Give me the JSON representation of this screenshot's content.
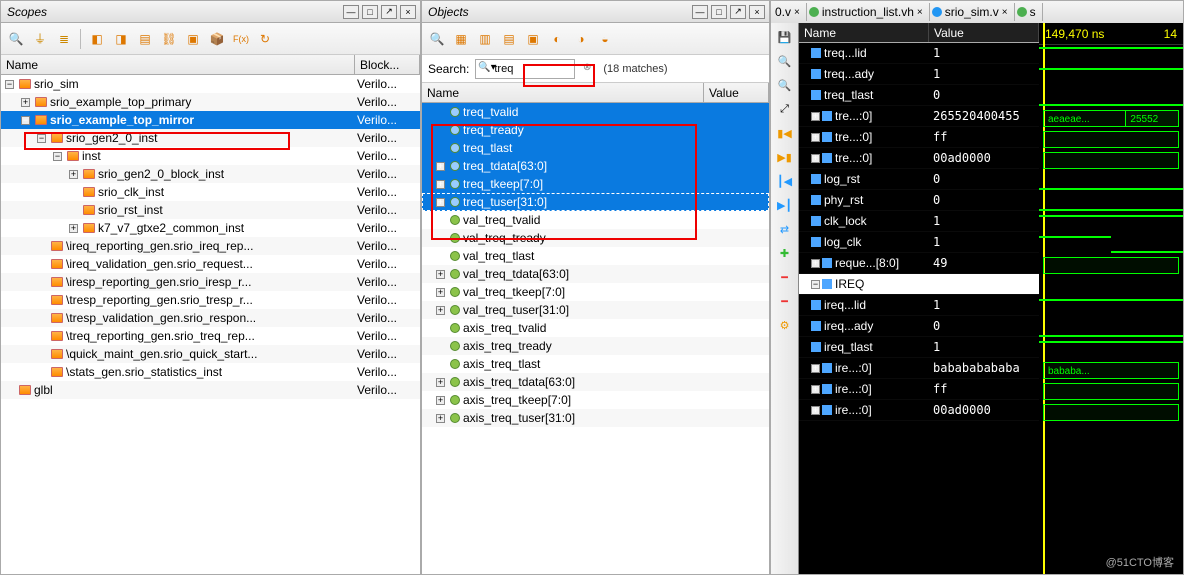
{
  "scopes": {
    "title": "Scopes",
    "col_name": "Name",
    "col_block": "Block...",
    "tree": [
      {
        "depth": 0,
        "exp": "-",
        "icon": "cube",
        "label": "srio_sim",
        "block": "Verilo..."
      },
      {
        "depth": 1,
        "exp": "+",
        "icon": "cube",
        "label": "srio_example_top_primary",
        "block": "Verilo...",
        "zebra": true
      },
      {
        "depth": 1,
        "exp": "-",
        "icon": "cube",
        "label": "srio_example_top_mirror",
        "block": "Verilo...",
        "sel": true,
        "red": true,
        "bold": true
      },
      {
        "depth": 2,
        "exp": "-",
        "icon": "cube",
        "label": "srio_gen2_0_inst",
        "block": "Verilo...",
        "zebra": true
      },
      {
        "depth": 3,
        "exp": "-",
        "icon": "cube",
        "label": "inst",
        "block": "Verilo..."
      },
      {
        "depth": 4,
        "exp": "+",
        "icon": "cube",
        "label": "srio_gen2_0_block_inst",
        "block": "Verilo...",
        "zebra": true
      },
      {
        "depth": 4,
        "exp": "",
        "icon": "cube",
        "label": "srio_clk_inst",
        "block": "Verilo..."
      },
      {
        "depth": 4,
        "exp": "",
        "icon": "cube",
        "label": "srio_rst_inst",
        "block": "Verilo...",
        "zebra": true
      },
      {
        "depth": 4,
        "exp": "+",
        "icon": "cube",
        "label": "k7_v7_gtxe2_common_inst",
        "block": "Verilo..."
      },
      {
        "depth": 2,
        "exp": "",
        "icon": "cube",
        "label": "\\ireq_reporting_gen.srio_ireq_rep...",
        "block": "Verilo...",
        "zebra": true
      },
      {
        "depth": 2,
        "exp": "",
        "icon": "cube",
        "label": "\\ireq_validation_gen.srio_request...",
        "block": "Verilo..."
      },
      {
        "depth": 2,
        "exp": "",
        "icon": "cube",
        "label": "\\iresp_reporting_gen.srio_iresp_r...",
        "block": "Verilo...",
        "zebra": true
      },
      {
        "depth": 2,
        "exp": "",
        "icon": "cube",
        "label": "\\tresp_reporting_gen.srio_tresp_r...",
        "block": "Verilo..."
      },
      {
        "depth": 2,
        "exp": "",
        "icon": "cube",
        "label": "\\tresp_validation_gen.srio_respon...",
        "block": "Verilo...",
        "zebra": true
      },
      {
        "depth": 2,
        "exp": "",
        "icon": "cube",
        "label": "\\treq_reporting_gen.srio_treq_rep...",
        "block": "Verilo..."
      },
      {
        "depth": 2,
        "exp": "",
        "icon": "cube",
        "label": "\\quick_maint_gen.srio_quick_start...",
        "block": "Verilo...",
        "zebra": true
      },
      {
        "depth": 2,
        "exp": "",
        "icon": "cube",
        "label": "\\stats_gen.srio_statistics_inst",
        "block": "Verilo..."
      },
      {
        "depth": 0,
        "exp": "",
        "icon": "cube",
        "label": "glbl",
        "block": "Verilo...",
        "zebra": true
      }
    ]
  },
  "objects": {
    "title": "Objects",
    "search_label": "Search:",
    "search_value": "treq",
    "matches": "(18 matches)",
    "col_name": "Name",
    "col_value": "Value",
    "list": [
      {
        "depth": 0,
        "icon": "port",
        "label": "treq_tvalid",
        "sel": true
      },
      {
        "depth": 0,
        "icon": "port",
        "label": "treq_tready",
        "sel": true
      },
      {
        "depth": 0,
        "icon": "port",
        "label": "treq_tlast",
        "sel": true
      },
      {
        "depth": 0,
        "exp": "+",
        "icon": "port",
        "label": "treq_tdata[63:0]",
        "sel": true
      },
      {
        "depth": 0,
        "exp": "+",
        "icon": "port",
        "label": "treq_tkeep[7:0]",
        "sel": true
      },
      {
        "depth": 0,
        "exp": "+",
        "icon": "port",
        "label": "treq_tuser[31:0]",
        "sel": true,
        "dashed": true
      },
      {
        "depth": 0,
        "icon": "port",
        "label": "val_treq_tvalid"
      },
      {
        "depth": 0,
        "icon": "port",
        "label": "val_treq_tready",
        "zebra": true
      },
      {
        "depth": 0,
        "icon": "port",
        "label": "val_treq_tlast"
      },
      {
        "depth": 0,
        "exp": "+",
        "icon": "port",
        "label": "val_treq_tdata[63:0]",
        "zebra": true
      },
      {
        "depth": 0,
        "exp": "+",
        "icon": "port",
        "label": "val_treq_tkeep[7:0]"
      },
      {
        "depth": 0,
        "exp": "+",
        "icon": "port",
        "label": "val_treq_tuser[31:0]",
        "zebra": true
      },
      {
        "depth": 0,
        "icon": "port",
        "label": "axis_treq_tvalid"
      },
      {
        "depth": 0,
        "icon": "port",
        "label": "axis_treq_tready",
        "zebra": true
      },
      {
        "depth": 0,
        "icon": "port",
        "label": "axis_treq_tlast"
      },
      {
        "depth": 0,
        "exp": "+",
        "icon": "port",
        "label": "axis_treq_tdata[63:0]",
        "zebra": true
      },
      {
        "depth": 0,
        "exp": "+",
        "icon": "port",
        "label": "axis_treq_tkeep[7:0]"
      },
      {
        "depth": 0,
        "exp": "+",
        "icon": "port",
        "label": "axis_treq_tuser[31:0]",
        "zebra": true
      }
    ]
  },
  "wave": {
    "tabs": [
      {
        "icon": "",
        "label": "0.v",
        "close": "×"
      },
      {
        "icon": "green",
        "label": "instruction_list.vh",
        "close": "×"
      },
      {
        "icon": "blue",
        "label": "srio_sim.v",
        "close": "×"
      },
      {
        "icon": "green",
        "label": "s",
        "close": ""
      }
    ],
    "col_name": "Name",
    "col_value": "Value",
    "time_label": "149,470 ns",
    "time_right": "14",
    "signals": [
      {
        "name": "treq...lid",
        "value": "1",
        "type": "bit",
        "high": true
      },
      {
        "name": "treq...ady",
        "value": "1",
        "type": "bit",
        "high": true
      },
      {
        "name": "treq_tlast",
        "value": "0",
        "type": "bit"
      },
      {
        "name": "tre...:0]",
        "value": "265520400455",
        "type": "bus",
        "bus": "aeaeae...",
        "bus2": "25552"
      },
      {
        "name": "tre...:0]",
        "value": "ff",
        "type": "bus",
        "bus": ""
      },
      {
        "name": "tre...:0]",
        "value": "00ad0000",
        "type": "bus",
        "bus": ""
      },
      {
        "name": "log_rst",
        "value": "0",
        "type": "bit"
      },
      {
        "name": "phy_rst",
        "value": "0",
        "type": "bit"
      },
      {
        "name": "clk_lock",
        "value": "1",
        "type": "bit",
        "high": true
      },
      {
        "name": "log_clk",
        "value": "1",
        "type": "clk"
      },
      {
        "name": "reque...[8:0]",
        "value": "49",
        "type": "bus",
        "bus": ""
      },
      {
        "name": "IREQ",
        "value": "",
        "type": "group",
        "sel": true
      },
      {
        "name": "ireq...lid",
        "value": "1",
        "type": "bit",
        "high": true
      },
      {
        "name": "ireq...ady",
        "value": "0",
        "type": "bit"
      },
      {
        "name": "ireq_tlast",
        "value": "1",
        "type": "bit",
        "high": true
      },
      {
        "name": "ire...:0]",
        "value": "babababababa",
        "type": "bus",
        "bus": "bababa..."
      },
      {
        "name": "ire...:0]",
        "value": "ff",
        "type": "bus",
        "bus": ""
      },
      {
        "name": "ire...:0]",
        "value": "00ad0000",
        "type": "bus",
        "bus": ""
      }
    ]
  },
  "watermark": "@51CTO博客"
}
